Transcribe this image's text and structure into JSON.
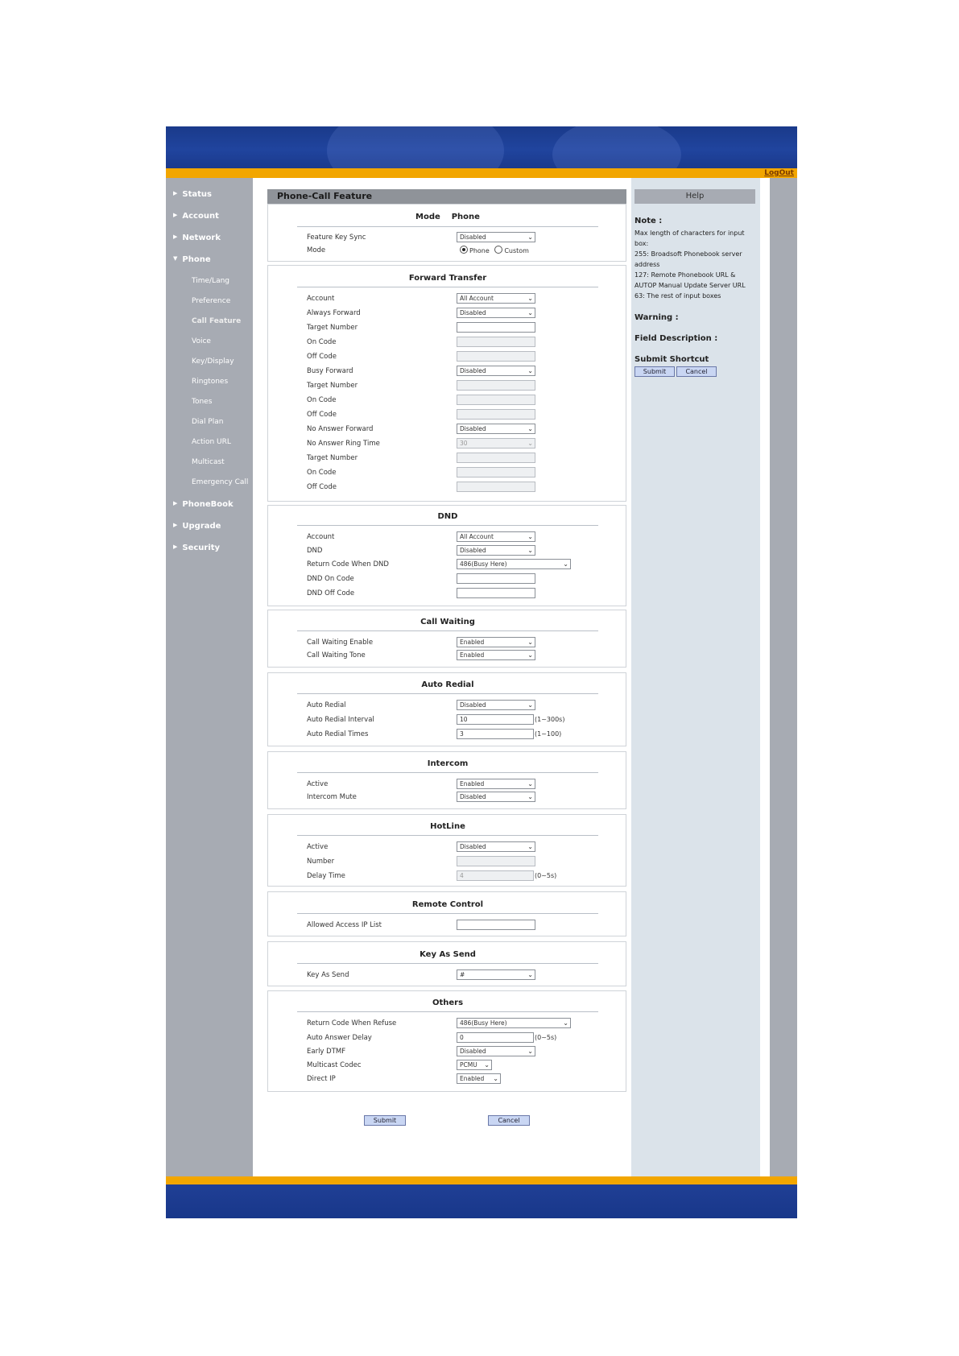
{
  "header": {
    "logout": "LogOut"
  },
  "nav": {
    "items": [
      "Status",
      "Account",
      "Network",
      "Phone"
    ],
    "phone_sub": [
      "Time/Lang",
      "Preference",
      "Call Feature",
      "Voice",
      "Key/Display",
      "Ringtones",
      "Tones",
      "Dial Plan",
      "Action URL",
      "Multicast",
      "Emergency Call"
    ],
    "bottom_items": [
      "PhoneBook",
      "Upgrade",
      "Security"
    ],
    "active_sub": "Call Feature"
  },
  "page": {
    "title": "Phone-Call Feature"
  },
  "mode": {
    "title": "Mode    Phone",
    "feature_key_sync": {
      "label": "Feature Key Sync",
      "value": "Disabled"
    },
    "mode": {
      "label": "Mode",
      "options": [
        "Phone",
        "Custom"
      ],
      "selected": "Phone"
    }
  },
  "forward": {
    "title": "Forward Transfer",
    "rows": [
      {
        "label": "Account",
        "value": "All Account"
      },
      {
        "label": "Always Forward",
        "value": "Disabled"
      },
      {
        "label": "Target Number",
        "value": ""
      },
      {
        "label": "On Code",
        "value": ""
      },
      {
        "label": "Off Code",
        "value": ""
      },
      {
        "label": "Busy Forward",
        "value": "Disabled"
      },
      {
        "label": "Target Number",
        "value": ""
      },
      {
        "label": "On Code",
        "value": ""
      },
      {
        "label": "Off Code",
        "value": ""
      },
      {
        "label": "No Answer Forward",
        "value": "Disabled"
      },
      {
        "label": "No Answer Ring Time",
        "value": "30"
      },
      {
        "label": "Target Number",
        "value": ""
      },
      {
        "label": "On Code",
        "value": ""
      },
      {
        "label": "Off Code",
        "value": ""
      }
    ]
  },
  "dnd": {
    "title": "DND",
    "rows": [
      {
        "label": "Account",
        "value": "All Account"
      },
      {
        "label": "DND",
        "value": "Disabled"
      },
      {
        "label": "Return Code When DND",
        "value": "486(Busy Here)"
      },
      {
        "label": "DND On Code",
        "value": ""
      },
      {
        "label": "DND Off Code",
        "value": ""
      }
    ]
  },
  "call_waiting": {
    "title": "Call Waiting",
    "rows": [
      {
        "label": "Call Waiting Enable",
        "value": "Enabled"
      },
      {
        "label": "Call Waiting Tone",
        "value": "Enabled"
      }
    ]
  },
  "auto_redial": {
    "title": "Auto Redial",
    "rows": [
      {
        "label": "Auto Redial",
        "value": "Disabled"
      },
      {
        "label": "Auto Redial Interval",
        "value": "10",
        "unit": "(1~300s)"
      },
      {
        "label": "Auto Redial Times",
        "value": "3",
        "unit": "(1~100)"
      }
    ]
  },
  "intercom": {
    "title": "Intercom",
    "rows": [
      {
        "label": "Active",
        "value": "Enabled"
      },
      {
        "label": "Intercom Mute",
        "value": "Disabled"
      }
    ]
  },
  "hotline": {
    "title": "HotLine",
    "rows": [
      {
        "label": "Active",
        "value": "Disabled"
      },
      {
        "label": "Number",
        "value": ""
      },
      {
        "label": "Delay Time",
        "value": "4",
        "unit": "(0~5s)"
      }
    ]
  },
  "remote_control": {
    "title": "Remote Control",
    "rows": [
      {
        "label": "Allowed Access IP List",
        "value": ""
      }
    ]
  },
  "key_as_send": {
    "title": "Key As Send",
    "rows": [
      {
        "label": "Key As Send",
        "value": "#"
      }
    ]
  },
  "others": {
    "title": "Others",
    "rows": [
      {
        "label": "Return Code When Refuse",
        "value": "486(Busy Here)"
      },
      {
        "label": "Auto Answer Delay",
        "value": "0",
        "unit": "(0~5s)"
      },
      {
        "label": "Early DTMF",
        "value": "Disabled"
      },
      {
        "label": "Multicast Codec",
        "value": "PCMU"
      },
      {
        "label": "Direct IP",
        "value": "Enabled"
      }
    ]
  },
  "actions": {
    "submit": "Submit",
    "cancel": "Cancel"
  },
  "help": {
    "header": "Help",
    "note_title": "Note :",
    "note_lines": [
      "Max length of characters for input box:",
      "255: Broadsoft Phonebook server address",
      "127: Remote Phonebook URL & AUTOP Manual Update Server URL",
      "63: The rest of input boxes"
    ],
    "warning_title": "Warning :",
    "field_desc_title": "Field Description :",
    "shortcut_title": "Submit Shortcut",
    "shortcut_submit": "Submit",
    "shortcut_cancel": "Cancel"
  }
}
